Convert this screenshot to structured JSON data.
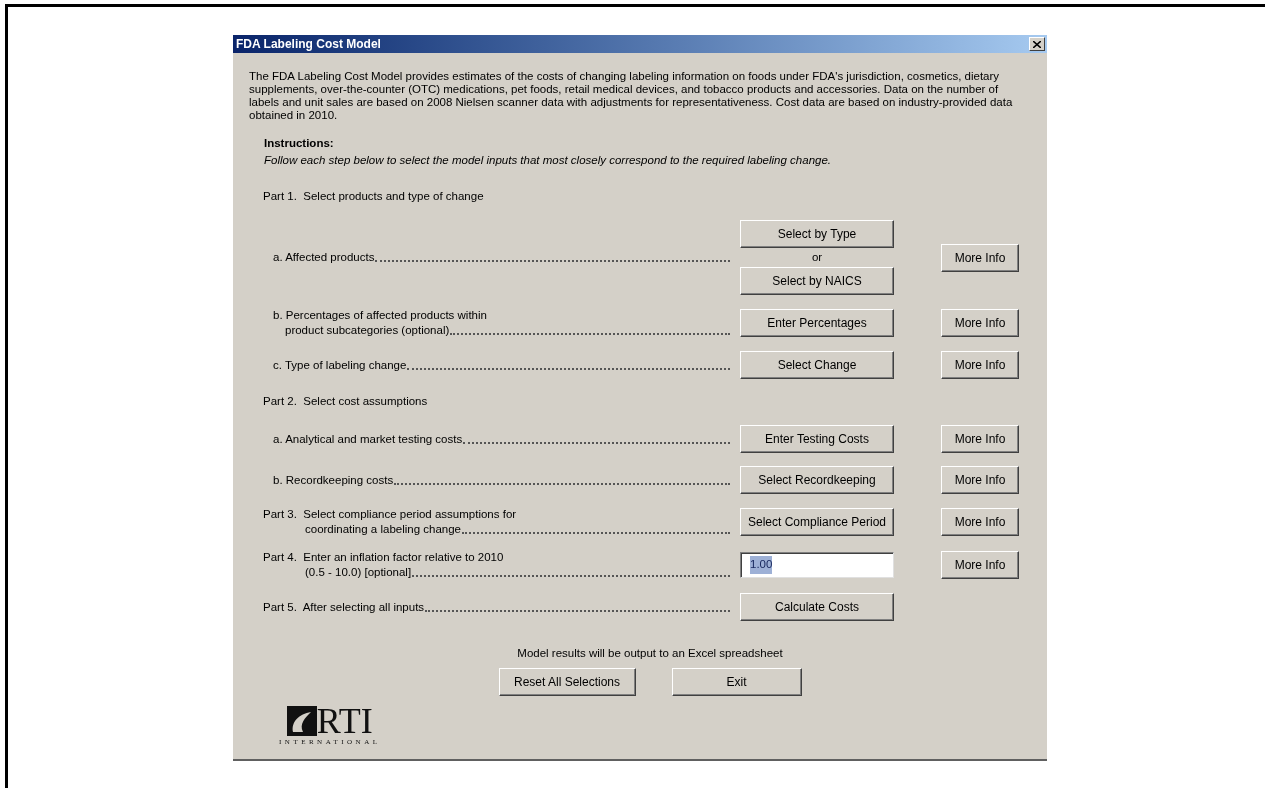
{
  "window": {
    "title": "FDA Labeling Cost Model"
  },
  "description": "The FDA Labeling Cost Model provides estimates of the costs of changing labeling information on foods under FDA's jurisdiction, cosmetics, dietary supplements, over-the-counter (OTC) medications, pet foods, retail medical devices, and tobacco products and accessories. Data on the number of labels and unit sales are based on 2008 Nielsen scanner data with adjustments for representativeness. Cost data are based on industry-provided data obtained in 2010.",
  "instructions": {
    "title": "Instructions:",
    "text": "Follow each step below to select the model inputs that most closely correspond to the required labeling change."
  },
  "rows": [
    {
      "kind": "heading",
      "lines": [
        "Part 1.  Select products and type of change"
      ]
    },
    {
      "kind": "item",
      "lines": [
        "a. Affected products"
      ],
      "buttons": [
        "Select by Type",
        "Select by NAICS"
      ],
      "separator": "or",
      "more_info": "More Info"
    },
    {
      "kind": "item",
      "lines": [
        "b. Percentages of affected products within",
        "product subcategories (optional)"
      ],
      "buttons": [
        "Enter Percentages"
      ],
      "more_info": "More Info"
    },
    {
      "kind": "item",
      "lines": [
        "c. Type of labeling change"
      ],
      "buttons": [
        "Select Change"
      ],
      "more_info": "More Info"
    },
    {
      "kind": "heading",
      "lines": [
        "Part 2.  Select cost assumptions"
      ]
    },
    {
      "kind": "item",
      "lines": [
        "a. Analytical and market testing costs"
      ],
      "buttons": [
        "Enter Testing Costs"
      ],
      "more_info": "More Info"
    },
    {
      "kind": "item",
      "lines": [
        "b. Recordkeeping costs"
      ],
      "buttons": [
        "Select Recordkeeping"
      ],
      "more_info": "More Info"
    },
    {
      "kind": "part",
      "lines": [
        "Part 3.  Select compliance period assumptions for",
        "coordinating a labeling change"
      ],
      "buttons": [
        "Select Compliance Period"
      ],
      "more_info": "More Info"
    },
    {
      "kind": "part",
      "lines": [
        "Part 4.  Enter an inflation factor relative to 2010",
        "(0.5 - 10.0) [optional]"
      ],
      "input": {
        "value": "1.00",
        "highlighted": true
      },
      "more_info": "More Info"
    },
    {
      "kind": "part",
      "lines": [
        "Part 5.  After selecting all inputs"
      ],
      "buttons": [
        "Calculate Costs"
      ]
    }
  ],
  "footer": {
    "note": "Model results will be output to an Excel spreadsheet",
    "buttons": [
      "Reset All Selections",
      "Exit"
    ]
  },
  "logo": {
    "name": "RTI",
    "subtitle": "INTERNATIONAL"
  }
}
